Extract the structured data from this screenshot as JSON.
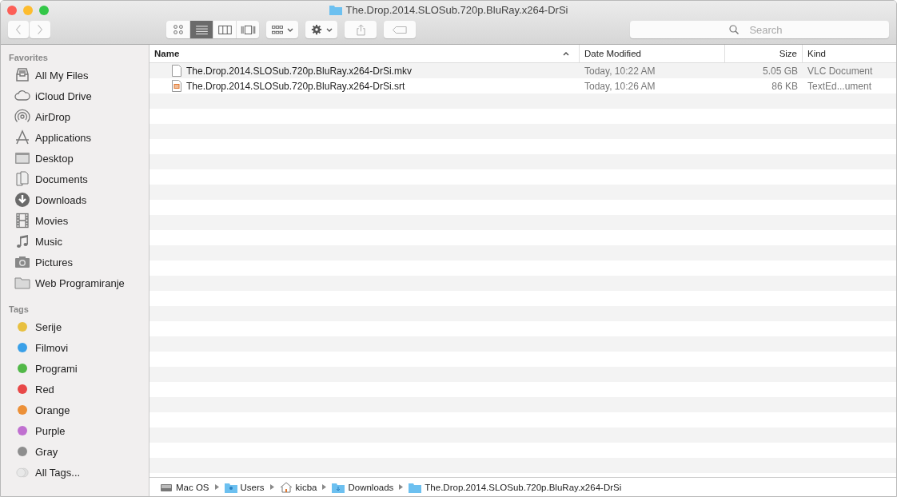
{
  "window": {
    "title": "The.Drop.2014.SLOSub.720p.BluRay.x264-DrSi"
  },
  "toolbar": {
    "views": [
      {
        "kind": "icons",
        "selected": false
      },
      {
        "kind": "list",
        "selected": true
      },
      {
        "kind": "columns",
        "selected": false
      },
      {
        "kind": "coverflow",
        "selected": false
      }
    ],
    "search": {
      "placeholder": "Search"
    }
  },
  "sidebar": {
    "favorites_heading": "Favorites",
    "favorites": [
      {
        "label": "All My Files",
        "kind": "files"
      },
      {
        "label": "iCloud Drive",
        "kind": "cloud"
      },
      {
        "label": "AirDrop",
        "kind": "airdrop"
      },
      {
        "label": "Applications",
        "kind": "apps"
      },
      {
        "label": "Desktop",
        "kind": "desktop"
      },
      {
        "label": "Documents",
        "kind": "documents"
      },
      {
        "label": "Downloads",
        "kind": "downloads"
      },
      {
        "label": "Movies",
        "kind": "movies"
      },
      {
        "label": "Music",
        "kind": "music"
      },
      {
        "label": "Pictures",
        "kind": "pictures"
      },
      {
        "label": "Web Programiranje",
        "kind": "folder"
      }
    ],
    "tags_heading": "Tags",
    "tags": [
      {
        "label": "Serije",
        "color": "#e8c040"
      },
      {
        "label": "Filmovi",
        "color": "#3aa0e8"
      },
      {
        "label": "Programi",
        "color": "#52b848"
      },
      {
        "label": "Red",
        "color": "#e84848"
      },
      {
        "label": "Orange",
        "color": "#ec9038"
      },
      {
        "label": "Purple",
        "color": "#c070d0"
      },
      {
        "label": "Gray",
        "color": "#8e8e8e"
      },
      {
        "label": "All Tags...",
        "kind": "all"
      }
    ]
  },
  "table": {
    "columns": [
      "Name",
      "Date Modified",
      "Size",
      "Kind"
    ],
    "rows": [
      {
        "name": "The.Drop.2014.SLOSub.720p.BluRay.x264-DrSi.mkv",
        "kind": "blank",
        "date": "Today, 10:22 AM",
        "size": "5.05 GB",
        "document_kind": "VLC Document"
      },
      {
        "name": "The.Drop.2014.SLOSub.720p.BluRay.x264-DrSi.srt",
        "kind": "text",
        "date": "Today, 10:26 AM",
        "size": "86 KB",
        "document_kind": "TextEd...ument"
      }
    ]
  },
  "path_bar": [
    {
      "label": "Mac OS",
      "kind": "disk"
    },
    {
      "label": "Users",
      "kind": "users"
    },
    {
      "label": "kicba",
      "kind": "home"
    },
    {
      "label": "Downloads",
      "kind": "downloads"
    },
    {
      "label": "The.Drop.2014.SLOSub.720p.BluRay.x264-DrSi",
      "kind": "folder"
    }
  ]
}
